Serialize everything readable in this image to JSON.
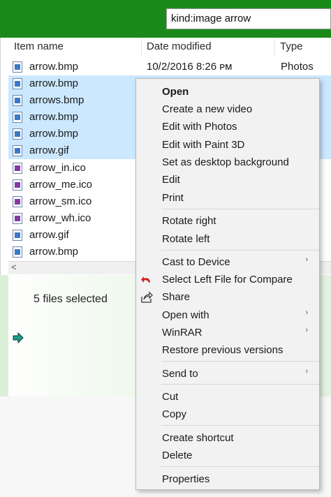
{
  "search": {
    "value": "kind:image arrow"
  },
  "columns": {
    "name": "Item name",
    "date": "Date modified",
    "type": "Type"
  },
  "files": [
    {
      "name": "arrow.bmp",
      "date": "10/2/2016 8:26 ᴘᴍ",
      "type": "Photos",
      "selected": false,
      "icon": "bitmap-file-icon"
    },
    {
      "name": "arrow.bmp",
      "selected": true,
      "icon": "bitmap-file-icon"
    },
    {
      "name": "arrows.bmp",
      "selected": true,
      "icon": "bitmap-file-icon"
    },
    {
      "name": "arrow.bmp",
      "selected": true,
      "icon": "bitmap-file-icon"
    },
    {
      "name": "arrow.bmp",
      "selected": true,
      "icon": "bitmap-file-icon"
    },
    {
      "name": "arrow.gif",
      "selected": true,
      "icon": "gif-file-icon"
    },
    {
      "name": "arrow_in.ico",
      "selected": false,
      "icon": "ico-file-icon"
    },
    {
      "name": "arrow_me.ico",
      "selected": false,
      "icon": "ico-file-icon"
    },
    {
      "name": "arrow_sm.ico",
      "selected": false,
      "icon": "ico-file-icon"
    },
    {
      "name": "arrow_wh.ico",
      "selected": false,
      "icon": "ico-file-icon"
    },
    {
      "name": "arrow.gif",
      "selected": false,
      "icon": "gif-file-icon"
    },
    {
      "name": "arrow.bmp",
      "selected": false,
      "icon": "bitmap-file-icon"
    }
  ],
  "scroll": {
    "left_arrow": "<"
  },
  "details": {
    "selection_count": "5 files selected"
  },
  "context_menu": {
    "open": "Open",
    "create_video": "Create a new video",
    "edit_photos": "Edit with Photos",
    "edit_paint3d": "Edit with Paint 3D",
    "set_background": "Set as desktop background",
    "edit": "Edit",
    "print": "Print",
    "rotate_right": "Rotate right",
    "rotate_left": "Rotate left",
    "cast": "Cast to Device",
    "select_left": "Select Left File for Compare",
    "share": "Share",
    "open_with": "Open with",
    "winrar": "WinRAR",
    "restore": "Restore previous versions",
    "send_to": "Send to",
    "cut": "Cut",
    "copy": "Copy",
    "create_shortcut": "Create shortcut",
    "delete": "Delete",
    "properties": "Properties",
    "submenu_chevron": "›"
  },
  "colors": {
    "titlebar_green": "#198a19",
    "selection_blue": "#cce8ff",
    "menu_bg": "#f2f2f2"
  }
}
